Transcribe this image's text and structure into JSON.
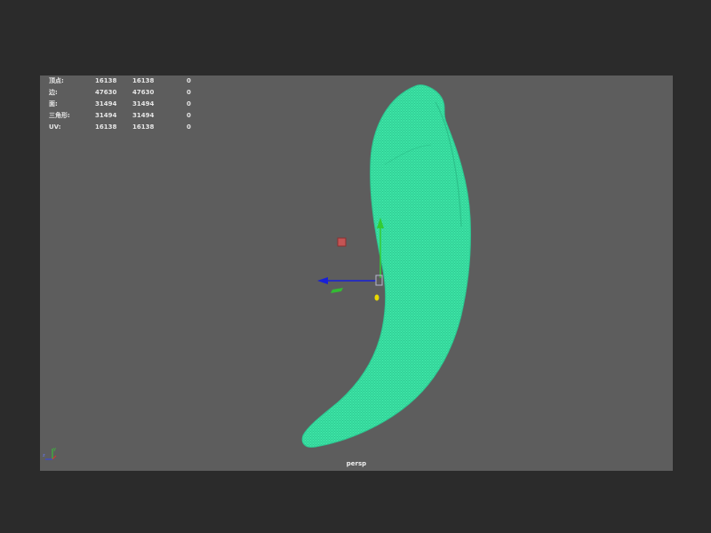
{
  "viewport": {
    "camera_label": "persp",
    "background_color": "#5d5d5d",
    "mesh_color": "#39e6a4"
  },
  "hud": {
    "rows": [
      {
        "label": "顶点:",
        "v1": "16138",
        "v2": "16138",
        "v3": "0"
      },
      {
        "label": "边:",
        "v1": "47630",
        "v2": "47630",
        "v3": "0"
      },
      {
        "label": "面:",
        "v1": "31494",
        "v2": "31494",
        "v3": "0"
      },
      {
        "label": "三角形:",
        "v1": "31494",
        "v2": "31494",
        "v3": "0"
      },
      {
        "label": "UV:",
        "v1": "16138",
        "v2": "16138",
        "v3": "0"
      }
    ]
  },
  "scene": {
    "object": "wireframe-mesh",
    "manipulator_icons": [
      "move-x-arrow-icon",
      "move-y-arrow-icon",
      "move-z-handle-icon",
      "center-handle-icon",
      "pivot-icon"
    ],
    "axis_indicator_icon": "view-axis-icon"
  }
}
